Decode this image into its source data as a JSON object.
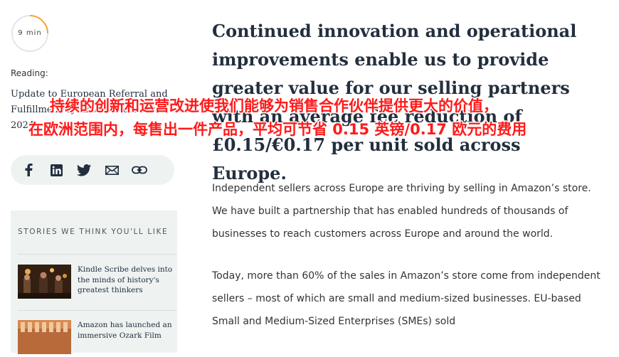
{
  "sidebar": {
    "read_time": "9 min",
    "reading_label": "Reading:",
    "reading_title": "Update to European Referral and Fulfillment by Amazon fees for 2024",
    "share_icons": [
      "facebook-icon",
      "linkedin-icon",
      "twitter-icon",
      "email-icon",
      "copy-link-icon"
    ],
    "stories": {
      "title": "STORIES WE THINK YOU'LL LIKE",
      "items": [
        {
          "text": "Kindle Scribe delves into the minds of history's greatest thinkers"
        },
        {
          "text": "Amazon has launched an immersive Ozark Film"
        }
      ]
    }
  },
  "main": {
    "headline": "Continued innovation and operational improvements enable us to provide greater value for our selling partners with an average fee reduction of £0.15/€0.17 per unit sold across Europe.",
    "paragraphs": [
      "Independent sellers across Europe are thriving by selling in Amazon’s store. We have built a partnership that has enabled hundreds of thousands of businesses to reach customers across Europe and around the world.",
      "Today, more than 60% of the sales in Amazon’s store come from independent sellers – most of which are small and medium-sized businesses. EU-based Small and Medium-Sized Enterprises (SMEs) sold"
    ]
  },
  "subtitle_overlay": {
    "line1": "持续的创新和运营改进使我们能够为销售合作伙伴提供更大的价值，",
    "line2": "在欧洲范围内，每售出一件产品，平均可节省 0.15 英镑/0.17 欧元的费用"
  },
  "colors": {
    "progress_accent": "#f4a53a",
    "panel_bg": "#eef3f2",
    "overlay_text": "#ff1a1a"
  }
}
